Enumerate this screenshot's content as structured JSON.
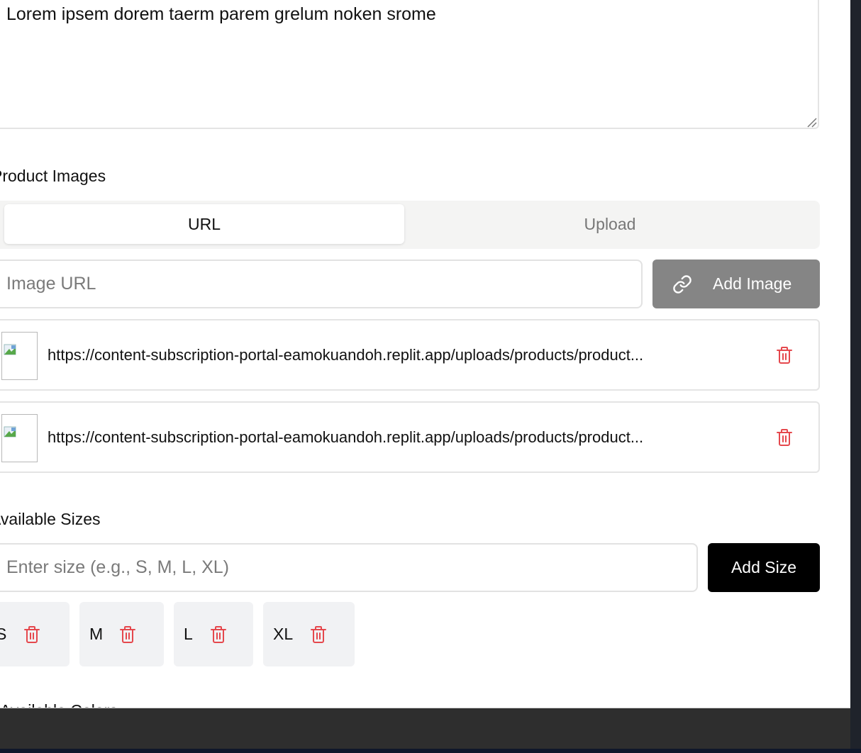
{
  "description": {
    "value": "Lorem ipsem dorem taerm parem grelum noken srome"
  },
  "product_images": {
    "label": "Product Images",
    "tabs": [
      {
        "label": "URL",
        "active": true
      },
      {
        "label": "Upload",
        "active": false
      }
    ],
    "url_input": {
      "placeholder": "Image URL",
      "value": ""
    },
    "add_button_label": "Add Image",
    "add_button_icon": "link-icon",
    "items": [
      {
        "url": "https://content-subscription-portal-eamokuandoh.replit.app/uploads/products/product-image-1.jpg",
        "display": "https://content-subscription-portal-eamokuandoh.replit.app/uploads/products/product..."
      },
      {
        "url": "https://content-subscription-portal-eamokuandoh.replit.app/uploads/products/product-image-2.jpg",
        "display": "https://content-subscription-portal-eamokuandoh.replit.app/uploads/products/product..."
      }
    ]
  },
  "available_sizes": {
    "label": "Available Sizes",
    "input": {
      "placeholder": "Enter size (e.g., S, M, L, XL)",
      "value": ""
    },
    "add_button_label": "Add Size",
    "sizes": [
      "S",
      "M",
      "L",
      "XL"
    ]
  },
  "next_section": {
    "label": "Available Colors"
  },
  "colors": {
    "delete_icon": "#e5484d",
    "primary_button": "#000000",
    "disabled_button": "#858585",
    "chip_background": "#f1f2f4",
    "bottom_bar": "#2e2e2e"
  }
}
